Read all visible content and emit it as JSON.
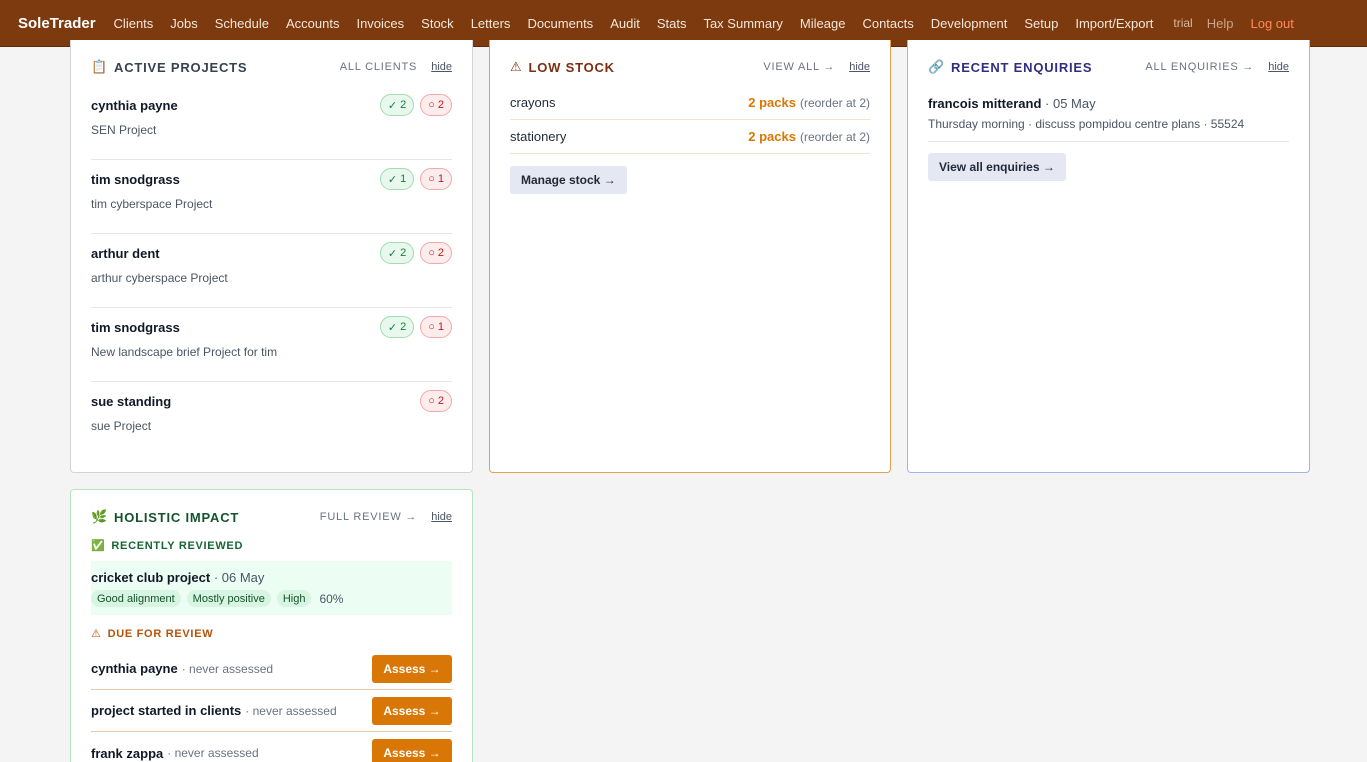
{
  "nav": {
    "brand": "SoleTrader",
    "items": [
      "Clients",
      "Jobs",
      "Schedule",
      "Accounts",
      "Invoices",
      "Stock",
      "Letters",
      "Documents",
      "Audit",
      "Stats",
      "Tax Summary",
      "Mileage",
      "Contacts",
      "Development",
      "Setup",
      "Import/Export"
    ],
    "trial": "trial",
    "help": "Help",
    "logout": "Log out"
  },
  "projects": {
    "icon": "clipboard-icon",
    "title": "ACTIVE PROJECTS",
    "link": "ALL CLIENTS",
    "hide": "hide",
    "items": [
      {
        "client": "cynthia payne",
        "project": "SEN Project",
        "done": "2",
        "open": "2"
      },
      {
        "client": "tim snodgrass",
        "project": "tim cyberspace Project",
        "done": "1",
        "open": "1"
      },
      {
        "client": "arthur dent",
        "project": "arthur cyberspace Project",
        "done": "2",
        "open": "2"
      },
      {
        "client": "tim snodgrass",
        "project": "New landscape brief Project for tim",
        "done": "2",
        "open": "1"
      },
      {
        "client": "sue standing",
        "project": "sue Project",
        "done": null,
        "open": "2"
      }
    ],
    "check_glyph": "✓",
    "open_glyph": "○"
  },
  "stock": {
    "icon": "⚠",
    "title": "LOW STOCK",
    "link": "VIEW ALL →",
    "hide": "hide",
    "items": [
      {
        "name": "crayons",
        "qty": "2 packs",
        "note": "(reorder at 2)"
      },
      {
        "name": "stationery",
        "qty": "2 packs",
        "note": "(reorder at 2)"
      }
    ],
    "button": "Manage stock →",
    "accent": "#d97706"
  },
  "enquiries": {
    "icon": "🔗",
    "title": "RECENT ENQUIRIES",
    "link": "ALL ENQUIRIES →",
    "hide": "hide",
    "item": {
      "name": "francois mitterand",
      "date": "· 05 May",
      "detail": "Thursday morning · discuss pompidou centre plans · 55524"
    },
    "button": "View all enquiries →"
  },
  "impact": {
    "icon": "🌿",
    "title": "HOLISTIC IMPACT",
    "link": "FULL REVIEW →",
    "hide": "hide",
    "reviewed_icon": "✅",
    "reviewed_title": "RECENTLY REVIEWED",
    "reviewed": {
      "name": "cricket club project",
      "date": "· 06 May",
      "tags": [
        "Good alignment",
        "Mostly positive",
        "High"
      ],
      "pct": "60%"
    },
    "due_icon": "⚠",
    "due_title": "DUE FOR REVIEW",
    "due": [
      {
        "name": "cynthia payne",
        "note": "· never assessed",
        "button": "Assess →"
      },
      {
        "name": "project started in clients",
        "note": "· never assessed",
        "button": "Assess →"
      },
      {
        "name": "frank zappa",
        "note": "· never assessed",
        "button": "Assess →"
      }
    ]
  }
}
